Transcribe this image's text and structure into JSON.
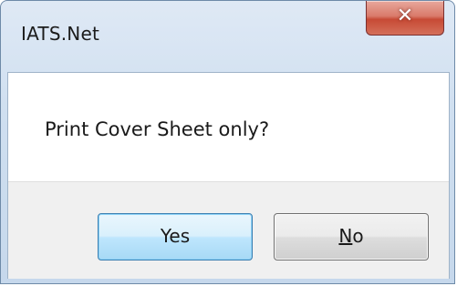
{
  "window": {
    "title": "IATS.Net",
    "close_icon": "close-icon"
  },
  "dialog": {
    "message": "Print Cover Sheet only?"
  },
  "buttons": {
    "yes_label": "Yes",
    "no_label": "No"
  },
  "colors": {
    "titlebar": "#cfdff0",
    "close_button": "#c74a35",
    "default_button_border": "#3c7fb1",
    "button_area": "#f0f0f0"
  }
}
